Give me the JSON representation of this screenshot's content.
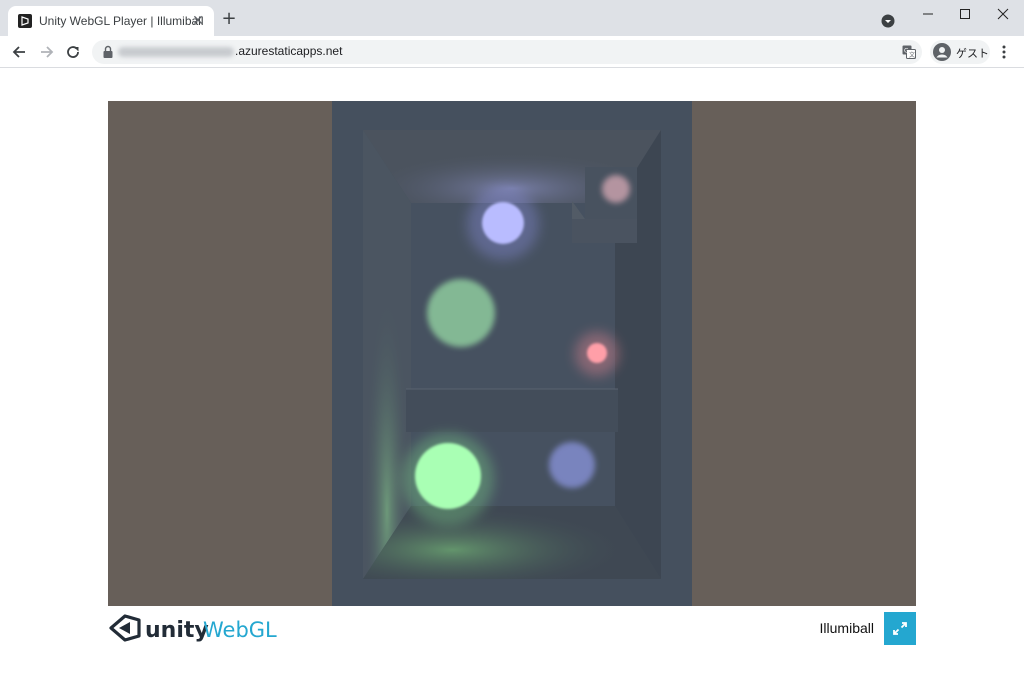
{
  "browser": {
    "tab_title": "Unity WebGL Player | Illumiball",
    "tab_close_glyph": "✕",
    "new_tab_glyph": "+",
    "url_domain": ".azurestaticapps.net",
    "profile_label": "ゲスト"
  },
  "footer": {
    "game_title": "Illumiball",
    "logo_unity_text": "unity",
    "logo_webgl_text": "WebGL"
  },
  "colors": {
    "canvas_background": "#675f59",
    "room": "#45505e",
    "webgl_blue": "#24a7d0"
  },
  "scene_lights": [
    {
      "color": "#b9bcff",
      "name": "blue-light-ball"
    },
    {
      "color": "#c7a0ac",
      "name": "pink-light-ball-on-ledge"
    },
    {
      "color": "#98dba6",
      "name": "green-light-ball"
    },
    {
      "color": "#ff9fa8",
      "name": "red-light-ball"
    },
    {
      "color": "#8f9ae6",
      "name": "blue-shadow-ball"
    },
    {
      "color": "#a9ffb4",
      "name": "green-player-ball"
    }
  ]
}
